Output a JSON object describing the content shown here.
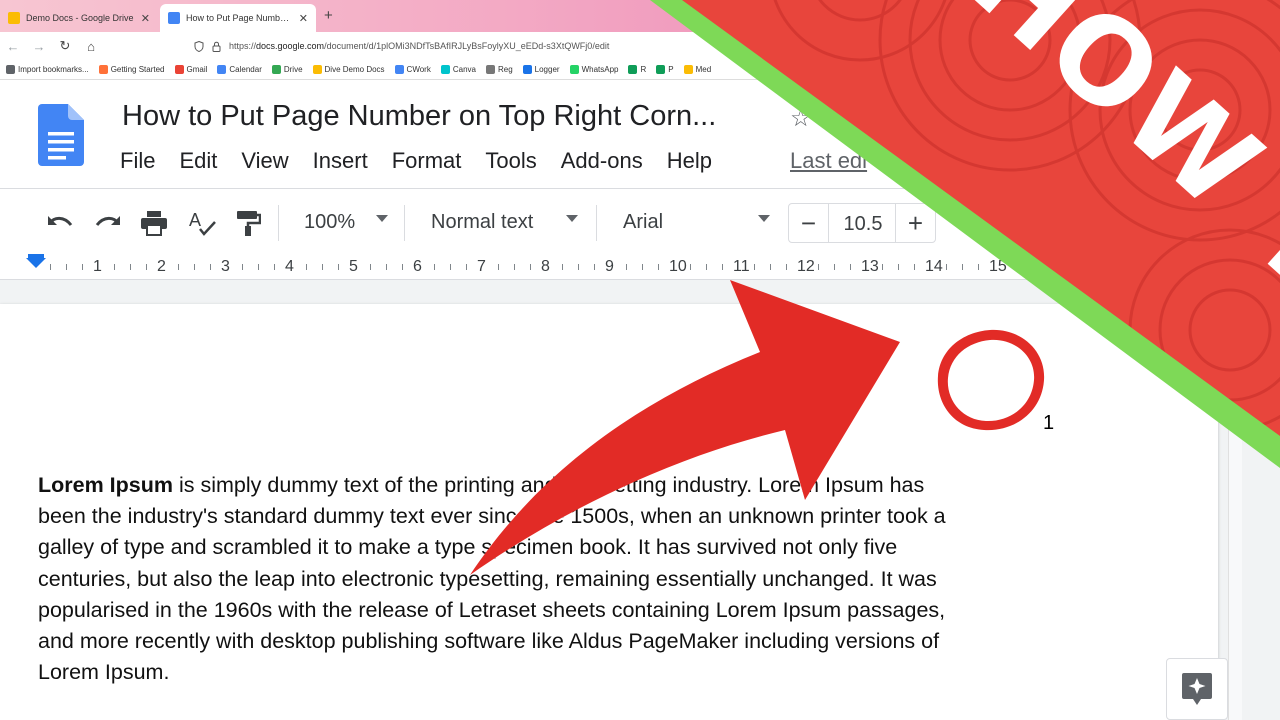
{
  "browser": {
    "tabs": [
      {
        "title": "Demo Docs - Google Drive",
        "favicon_color": "#fbbc04"
      },
      {
        "title": "How to Put Page Number on To",
        "favicon_color": "#4285f4"
      }
    ],
    "new_tab_symbol": "+",
    "url_prefix": "https://",
    "url_host": "docs.google.com",
    "url_path": "/document/d/1plOMi3NDfTsBAfIRJLyBsFoylyXU_eEDd-s3XtQWFj0/edit",
    "bookmarks": [
      {
        "label": "Import bookmarks...",
        "color": "#5f6368"
      },
      {
        "label": "Getting Started",
        "color": "#ff7139"
      },
      {
        "label": "Gmail",
        "color": "#ea4335"
      },
      {
        "label": "Calendar",
        "color": "#4285f4"
      },
      {
        "label": "Drive",
        "color": "#34a853"
      },
      {
        "label": "Dive Demo Docs",
        "color": "#fbbc04"
      },
      {
        "label": "CWork",
        "color": "#4285f4"
      },
      {
        "label": "Canva",
        "color": "#00c4cc"
      },
      {
        "label": "Reg",
        "color": "#777777"
      },
      {
        "label": "Logger",
        "color": "#1a73e8"
      },
      {
        "label": "WhatsApp",
        "color": "#25d366"
      },
      {
        "label": "R",
        "color": "#0f9d58"
      },
      {
        "label": "P",
        "color": "#0f9d58"
      },
      {
        "label": "Med",
        "color": "#fbbc04"
      }
    ]
  },
  "docs": {
    "title": "How to Put Page Number on Top Right Corn...",
    "menu": [
      "File",
      "Edit",
      "View",
      "Insert",
      "Format",
      "Tools",
      "Add-ons",
      "Help"
    ],
    "last_edit": "Last edi",
    "toolbar": {
      "zoom": "100%",
      "style": "Normal text",
      "font": "Arial",
      "font_size": "10.5",
      "minus": "−",
      "plus": "+"
    },
    "ruler_numbers": [
      "1",
      "2",
      "3",
      "4",
      "5",
      "6",
      "7",
      "8",
      "9",
      "10",
      "11",
      "12",
      "13",
      "14",
      "15"
    ],
    "page_number": "1",
    "body_bold": "Lorem Ipsum",
    "body_lines": [
      " is simply dummy text of the printing and typesetting industry. Lorem Ipsum has",
      "been the industry's standard dummy text ever since the 1500s, when an unknown printer took a",
      "galley of type and scrambled it to make a type specimen book. It has survived not only five",
      "centuries, but also the leap into electronic typesetting, remaining essentially unchanged. It was",
      "popularised in the 1960s with the release of Letraset sheets containing Lorem Ipsum passages,",
      "and more recently with desktop publishing software like Aldus PageMaker including versions of",
      "Lorem Ipsum."
    ]
  },
  "overlay": {
    "howto_text": "HOW TO",
    "arrow_color": "#e22b26",
    "banner_color": "#e8453c",
    "stripe_color": "#7ed957"
  }
}
